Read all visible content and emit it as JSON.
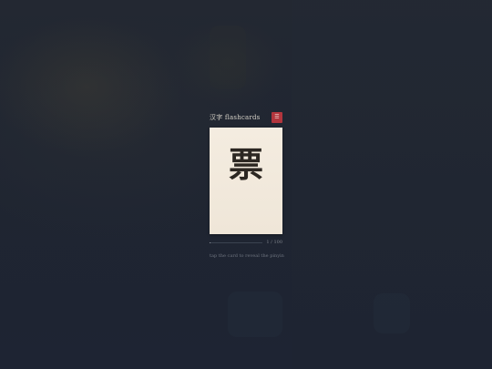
{
  "header": {
    "title": "汉字 flashcards",
    "menu_icon_label": "☰"
  },
  "card": {
    "character": "票"
  },
  "progress": {
    "counter": "1 / 100",
    "fraction": 0.01
  },
  "hint": "tap the card to reveal the pinyin",
  "colors": {
    "accent": "#b2353d",
    "card": "#f3ebdf",
    "background": "#1e2433"
  }
}
